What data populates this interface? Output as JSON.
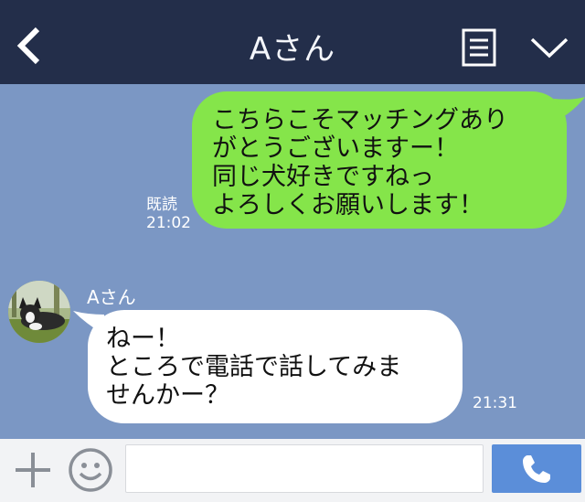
{
  "header": {
    "title": "Aさん",
    "back_icon": "chevron-left-icon",
    "menu_icon": "list-menu-icon",
    "collapse_icon": "chevron-down-icon",
    "background": "#232e4a"
  },
  "messages": {
    "outgoing": {
      "lines": [
        "こちらこそマッチングあり",
        "がとうございますー！",
        "同じ犬好きですねっ",
        "よろしくお願いします！"
      ],
      "read_label": "既読",
      "time": "21:02",
      "bubble_color": "#85e54a"
    },
    "incoming": {
      "sender": "Aさん",
      "lines": [
        "ねー！",
        "ところで電話で話してみま",
        "せんかー？"
      ],
      "time": "21:31",
      "bubble_color": "#ffffff"
    }
  },
  "footer": {
    "input_value": "",
    "add_icon": "plus-icon",
    "sticker_icon": "smiley-icon",
    "call_icon": "phone-icon",
    "call_button_color": "#5b8ed9"
  }
}
